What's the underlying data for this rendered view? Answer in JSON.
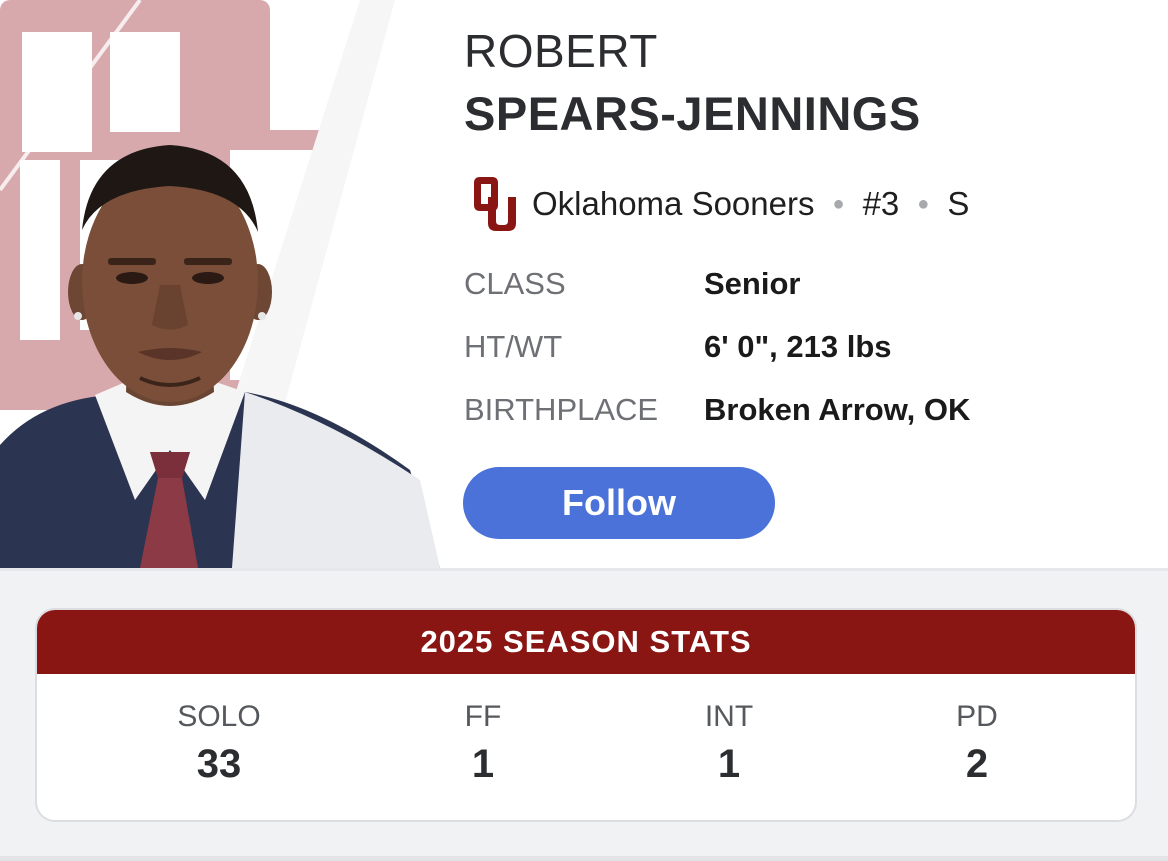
{
  "player": {
    "first_name": "ROBERT",
    "last_name": "SPEARS-JENNINGS",
    "team": "Oklahoma Sooners",
    "number": "#3",
    "position": "S",
    "team_logo_icon": "oklahoma-ou-logo",
    "follow_label": "Follow"
  },
  "info": [
    {
      "label": "CLASS",
      "value": "Senior"
    },
    {
      "label": "HT/WT",
      "value": "6' 0\", 213 lbs"
    },
    {
      "label": "BIRTHPLACE",
      "value": "Broken Arrow, OK"
    }
  ],
  "stats": {
    "title": "2025 SEASON STATS",
    "items": [
      {
        "label": "SOLO",
        "value": "33"
      },
      {
        "label": "FF",
        "value": "1"
      },
      {
        "label": "INT",
        "value": "1"
      },
      {
        "label": "PD",
        "value": "2"
      }
    ]
  },
  "colors": {
    "brand_crimson": "#8a1613",
    "follow_blue": "#4a72d9",
    "watermark_pink": "#d7a9ad"
  }
}
